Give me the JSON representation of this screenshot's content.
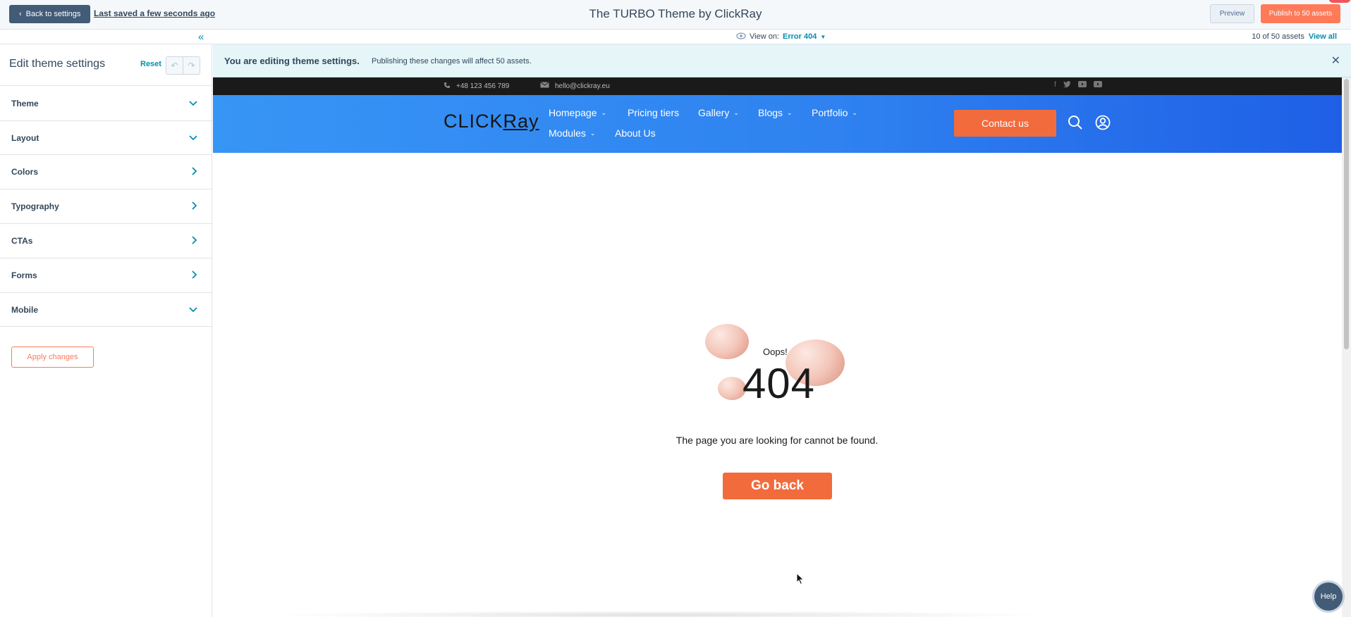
{
  "header": {
    "back_label": "Back to settings",
    "saved_label": "Last saved a few seconds ago",
    "title": "The TURBO Theme by ClickRay",
    "preview_label": "Preview",
    "publish_label": "Publish to 50 assets"
  },
  "subheader": {
    "view_on_label": "View on:",
    "view_on_value": "Error 404",
    "assets_count": "10 of 50 assets",
    "view_all_label": "View all"
  },
  "sidebar": {
    "title": "Edit theme settings",
    "reset_label": "Reset",
    "items": [
      {
        "label": "Theme",
        "icon": "chevron-down-icon"
      },
      {
        "label": "Layout",
        "icon": "chevron-down-icon"
      },
      {
        "label": "Colors",
        "icon": "chevron-right-icon"
      },
      {
        "label": "Typography",
        "icon": "chevron-right-icon"
      },
      {
        "label": "CTAs",
        "icon": "chevron-right-icon"
      },
      {
        "label": "Forms",
        "icon": "chevron-right-icon"
      },
      {
        "label": "Mobile",
        "icon": "chevron-down-icon"
      }
    ],
    "apply_label": "Apply changes"
  },
  "banner": {
    "strong": "You are editing theme settings.",
    "text": "Publishing these changes will affect 50 assets."
  },
  "site": {
    "phone": "+48 123 456 789",
    "email": "hello@clickray.eu",
    "logo_text": "CLICK",
    "logo_text2": "Ray",
    "nav": [
      "Homepage",
      "Pricing tiers",
      "Gallery",
      "Blogs",
      "Portfolio",
      "Modules",
      "About Us"
    ],
    "contact_label": "Contact us",
    "oops": "Oops!",
    "code": "404",
    "message": "The page you are looking for cannot be found.",
    "go_back_label": "Go back"
  },
  "help_label": "Help",
  "colors": {
    "accent_orange": "#ff7a59",
    "site_orange": "#f26b3c",
    "teal": "#0091ae",
    "nav_blue": "#2f82f0",
    "dark_slate": "#425b76"
  }
}
